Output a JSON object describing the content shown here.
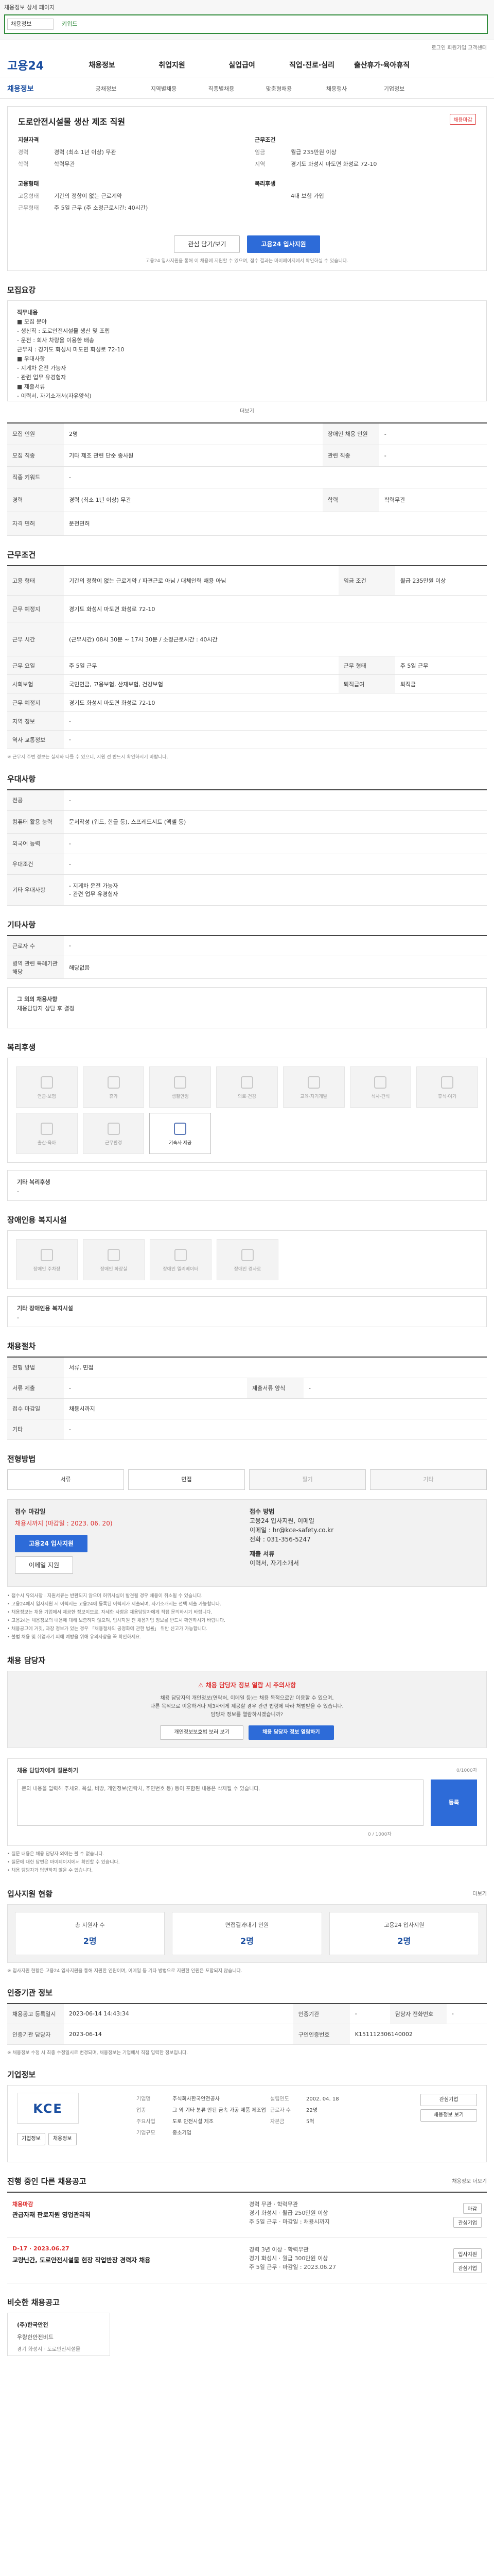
{
  "topbar": {
    "note": "채용정보 상세 페이지",
    "search_tag": "채용정보",
    "search_chip": "키워드"
  },
  "top_utils": "로그인  회원가입  고객센터",
  "gnb": {
    "logo": "고용24",
    "items": [
      "채용정보",
      "취업지원",
      "실업급여",
      "직업·진로·심리",
      "출산휴가·육아휴직"
    ]
  },
  "lnb": {
    "crumb": "채용정보",
    "items": [
      "공채정보",
      "지역별채용",
      "직종별채용",
      "맞춤형채용",
      "채용행사",
      "기업정보"
    ]
  },
  "summary": {
    "company": "도로안전시설물 생산 제조 직원",
    "badge": "채용마감",
    "left_title": "지원자격",
    "left_rows": [
      {
        "k": "경력",
        "v": "경력 (최소 1년 이상) 무관"
      },
      {
        "k": "학력",
        "v": "학력무관"
      }
    ],
    "left_title2": "고용형태",
    "left_rows2": [
      {
        "k": "고용형태",
        "v": "기간의 정함이 없는 근로계약"
      },
      {
        "k": "근무형태",
        "v": "주 5일 근무 (주 소정근로시간: 40시간)"
      }
    ],
    "right_title": "근무조건",
    "right_rows": [
      {
        "k": "임금",
        "v": "월급 235만원 이상"
      },
      {
        "k": "지역",
        "v": "경기도 화성시 마도면 화성로 72-10"
      }
    ],
    "right_title2": "복리후생",
    "right_rows2": [
      {
        "k": "",
        "v": "4대 보험 가입"
      }
    ],
    "btn_scrap": "관심 담기/보기",
    "btn_apply": "고용24 입사지원",
    "hint": "고용24 입사지원을 통해 이 채용에 지원할 수 있으며, 접수 결과는 마이페이지에서 확인하실 수 있습니다."
  },
  "recruit": {
    "title": "모집요강",
    "body_lines": [
      "직무내용",
      "■ 모집 분야",
      "- 생산직 : 도로안전시설물 생산 및 조립",
      "- 운전 : 회사 차량을 이용한 배송",
      "근무처 : 경기도 화성시 마도면 화성로 72-10",
      "■ 우대사항",
      "- 지게차 운전 가능자",
      "- 관련 업무 유경험자",
      "■ 제출서류",
      "- 이력서, 자기소개서(자유양식)"
    ],
    "more": "더보기"
  },
  "recruit_table": {
    "rows": [
      {
        "k": "모집 인원",
        "v": "2명",
        "k2": "장애인 채용 인원",
        "v2": "-"
      },
      {
        "k": "모집 직종",
        "v": "기타 제조 관련 단순 종사원",
        "k2": "관련 직종",
        "v2": "-"
      },
      {
        "k": "직종 키워드",
        "v": "-",
        "k2": "",
        "v2": ""
      },
      {
        "k": "경력",
        "v": "경력 (최소 1년 이상) 무관",
        "k2": "학력",
        "v2": "학력무관"
      },
      {
        "k": "자격 면허",
        "v": "운전면허",
        "k2": "",
        "v2": ""
      }
    ]
  },
  "work": {
    "title": "근무조건",
    "rows": [
      {
        "k": "고용 형태",
        "v": "기간의 정함이 없는 근로계약 / 파견근로 아님 / 대체인력 채용 아님",
        "k2": "임금 조건",
        "v2": "월급 235만원 이상"
      },
      {
        "k": "근무 예정지",
        "v": "경기도 화성시 마도면 화성로 72-10",
        "k2": "",
        "v2": ""
      },
      {
        "k": "근무 시간",
        "v": "(근무시간) 08시 30분 ~ 17시 30분 / 소정근로시간 : 40시간",
        "k2": "",
        "v2": ""
      },
      {
        "k": "근무 요일",
        "v": "주 5일 근무",
        "k2": "근무 형태",
        "v2": "주 5일 근무"
      },
      {
        "k": "사회보험",
        "v": "국민연금, 고용보험, 산재보험, 건강보험",
        "k2": "퇴직급여",
        "v2": "퇴직금"
      },
      {
        "k": "근무 예정지",
        "v": "경기도 화성시 마도면 화성로 72-10",
        "k2": "",
        "v2": ""
      },
      {
        "k": "지역 정보",
        "v": "-",
        "k2": "",
        "v2": ""
      },
      {
        "k": "역사 교통정보",
        "v": "-",
        "k2": "",
        "v2": ""
      }
    ],
    "note": "※ 근무지 주변 정보는 실제와 다를 수 있으니, 지원 전 반드시 확인하시기 바랍니다."
  },
  "prefer": {
    "title": "우대사항",
    "rows": [
      {
        "k": "전공",
        "v": "-"
      },
      {
        "k": "컴퓨터 활용 능력",
        "v": "문서작성 (워드, 한글 등), 스프레드시트 (엑셀 등)"
      },
      {
        "k": "외국어 능력",
        "v": "-"
      },
      {
        "k": "우대조건",
        "v": "-"
      },
      {
        "k": "기타 우대사항",
        "v": "- 지게차 운전 가능자\n- 관련 업무 유경험자"
      }
    ]
  },
  "etc": {
    "title": "기타사항",
    "rows": [
      {
        "k": "근로자 수",
        "v": "-"
      },
      {
        "k": "병역 관련 특례기관 해당",
        "v": "해당없음"
      }
    ],
    "extra_title": "그 외의 채용사항",
    "extra_body": "채용담당자 상담 후 결정"
  },
  "welfare": {
    "title": "복리후생",
    "items": [
      "연금·보험",
      "휴가",
      "생활안정",
      "의료·건강",
      "교육·자기개발",
      "식사·간식",
      "휴식·여가",
      "출산·육아",
      "근무환경",
      "기숙사 제공"
    ],
    "extra_label": "기타 복리후생",
    "extra_value": "-"
  },
  "disability": {
    "title": "장애인용 복지시설",
    "items": [
      "장애인 주차장",
      "장애인 화장실",
      "장애인 엘리베이터",
      "장애인 경사로"
    ],
    "extra_label": "기타 장애인용 복지시설",
    "extra_value": "-"
  },
  "process": {
    "title": "채용절차",
    "rows": [
      {
        "k": "전형 방법",
        "v": "서류, 면접",
        "k2": "",
        "v2": ""
      },
      {
        "k": "서류 제출",
        "v": "-",
        "k2": "제출서류 양식",
        "v2": "-"
      },
      {
        "k": "접수 마감일",
        "v": "채용시까지",
        "k2": "",
        "v2": ""
      },
      {
        "k": "기타",
        "v": "-",
        "k2": "",
        "v2": ""
      }
    ]
  },
  "apply_method": {
    "title": "전형방법",
    "methods": [
      {
        "label": "서류",
        "on": true
      },
      {
        "label": "면접",
        "on": true
      },
      {
        "label": "필기",
        "on": false
      },
      {
        "label": "기타",
        "on": false
      }
    ],
    "left_label": "접수 마감일",
    "left_value": "채용시까지 (마감일 : 2023. 06. 20)",
    "left_btn1": "고용24 입사지원",
    "left_btn2": "이메일 지원",
    "right_label": "접수 방법",
    "right_lines": [
      "고용24 입사지원, 이메일",
      "이메일 : hr@kce-safety.co.kr",
      "전화 : 031-356-5247"
    ],
    "right_label2": "제출 서류",
    "right_value2": "이력서, 자기소개서",
    "notes": [
      "• 접수시 유의사항 : 지원서류는 반환되지 않으며 허위사실이 발견될 경우 채용이 취소될 수 있습니다.",
      "• 고용24에서 입사지원 시 이력서는 고용24에 등록된 이력서가 제출되며, 자기소개서는 선택 제출 가능합니다.",
      "• 채용정보는 채용 기업에서 제공한 정보이므로, 자세한 사항은 채용담당자에게 직접 문의하시기 바랍니다.",
      "• 고용24는 채용정보의 내용에 대해 보증하지 않으며, 입사지원 전 채용기업 정보를 반드시 확인하시기 바랍니다.",
      "• 채용공고에 거짓, 과장 정보가 있는 경우 「채용절차의 공정화에 관한 법률」 위반 신고가 가능합니다.",
      "• 불법 채용 및 취업사기 피해 예방을 위해 유의사항을 꼭 확인하세요."
    ]
  },
  "contact": {
    "title": "채용 담당자",
    "alert": "채용 담당자 정보 열람 시 주의사항",
    "alert_lines": [
      "채용 담당자의 개인정보(연락처, 이메일 등)는 채용 목적으로만 이용할 수 있으며,",
      "다른 목적으로 이용하거나 제3자에게 제공할 경우 관련 법령에 따라 처벌받을 수 있습니다.",
      "담당자 정보를 열람하시겠습니까?"
    ],
    "btn1": "개인정보보호법 보러 보기",
    "btn2": "채용 담당자 정보 열람하기"
  },
  "inquiry": {
    "title": "채용 담당자에게 질문하기",
    "meta": "0/1000자",
    "placeholder": "문의 내용을 입력해 주세요. 욕설, 비방, 개인정보(연락처, 주민번호 등) 등이 포함된 내용은 삭제될 수 있습니다.",
    "counter": "0 / 1000자",
    "btn": "등록",
    "notes": [
      "• 질문 내용은 채용 담당자 외에는 볼 수 없습니다.",
      "• 질문에 대한 답변은 마이페이지에서 확인할 수 있습니다.",
      "• 채용 담당자가 답변하지 않을 수 있습니다."
    ]
  },
  "applicants": {
    "title": "입사지원 현황",
    "link": "더보기",
    "stats": [
      {
        "lbl": "총 지원자 수",
        "val": "2명"
      },
      {
        "lbl": "면접결과대기 인원",
        "val": "2명"
      },
      {
        "lbl": "고용24 입사지원",
        "val": "2명"
      }
    ],
    "note": "※ 입사지원 현황은 고용24 입사지원을 통해 지원한 인원이며, 이메일 등 기타 방법으로 지원한 인원은 포함되지 않습니다."
  },
  "reg": {
    "title": "인증기관 정보",
    "rows": [
      {
        "k": "채용공고 등록일시",
        "v": "2023-06-14 14:43:34",
        "k2": "인증기관",
        "v2": "-",
        "k3": "담당자 전화번호",
        "v3": "-"
      },
      {
        "k": "인증기관 담당자",
        "v": "2023-06-14",
        "k2": "구인인증번호",
        "v2": "K151112306140002",
        "k3": "",
        "v3": ""
      }
    ],
    "note": "※ 채용정보 수정 시 최종 수정일시로 변경되며, 채용정보는 기업에서 직접 입력한 정보입니다."
  },
  "company": {
    "title": "기업정보",
    "logo_text": "KCE",
    "btn1": "기업정보",
    "btn2": "채용정보",
    "rows": [
      {
        "k": "기업명",
        "v": "주식회사한국안전공사",
        "k2": "설립연도",
        "v2": "2002. 04. 18"
      },
      {
        "k": "업종",
        "v": "그 외 기타 분류 안된 금속 가공 제품 제조업",
        "k2": "근로자 수",
        "v2": "22명"
      },
      {
        "k": "주요사업",
        "v": "도로 안전시설 제조",
        "k2": "자본금",
        "v2": "5억"
      },
      {
        "k": "기업규모",
        "v": "중소기업",
        "k2": "",
        "v2": ""
      }
    ],
    "side_btn1": "관심기업",
    "side_btn2": "채용정보 보기"
  },
  "other_jobs": {
    "title": "진행 중인 다른 채용공고",
    "link": "채용정보 더보기",
    "items": [
      {
        "co": "채용마감",
        "title": "관급자재 판로지원 영업관리직",
        "meta": [
          "경력 무관",
          "학력무관",
          "경기 화성시",
          "월급 250만원 이상",
          "주 5일 근무",
          "마감일 : 채용시까지"
        ],
        "side1": "마감",
        "side2": "관심기업"
      },
      {
        "co": "D-17 · 2023.06.27",
        "title": "교량난간, 도로안전시설물 현장 작업반장 경력자 채용",
        "meta": [
          "경력 3년 이상",
          "학력무관",
          "경기 화성시",
          "월급 300만원 이상",
          "주 5일 근무",
          "마감일 : 2023.06.27"
        ],
        "side1": "입사지원",
        "side2": "관심기업"
      }
    ]
  },
  "similar": {
    "title": "비슷한 채용공고",
    "item_co": "(주)한국안전",
    "item_sub": "우량한안전비드",
    "item_meta": "경기 화성시 · 도로안전시설물"
  }
}
